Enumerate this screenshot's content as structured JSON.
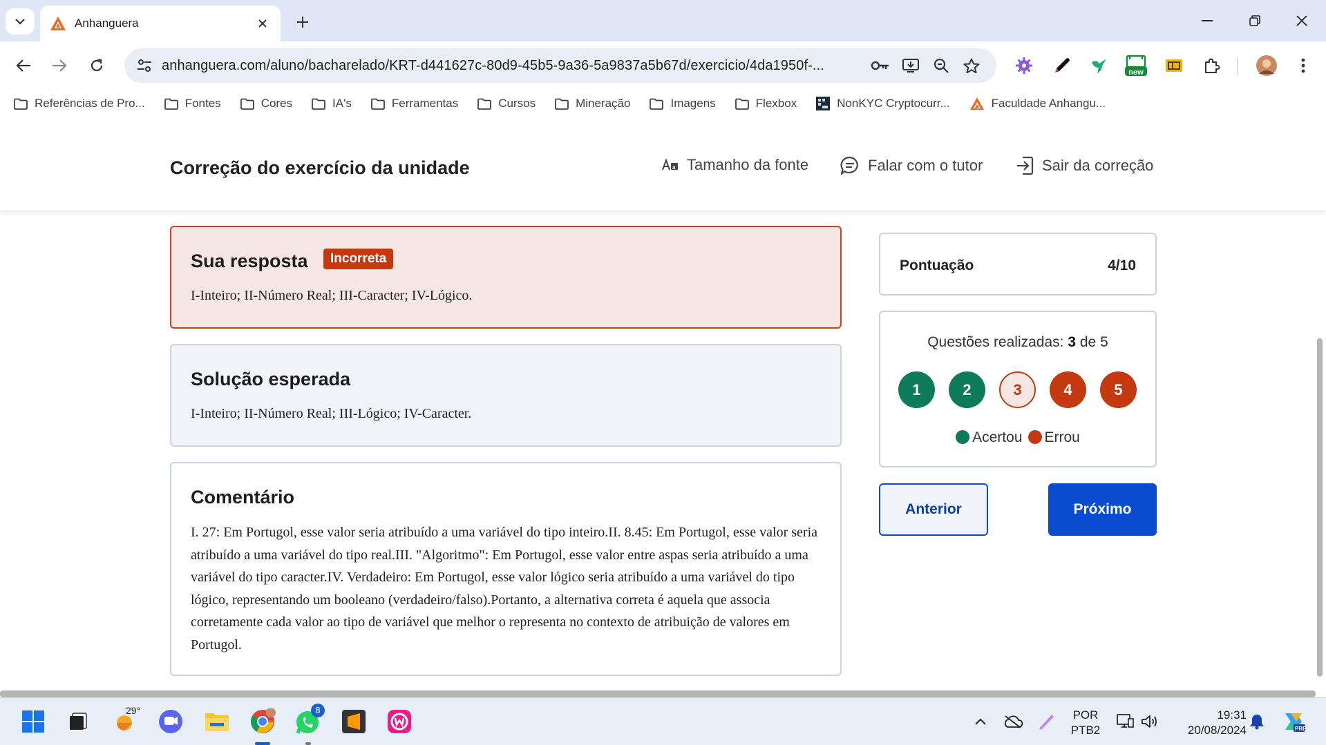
{
  "browser": {
    "tab_title": "Anhanguera",
    "url": "anhanguera.com/aluno/bacharelado/KRT-d441627c-80d9-45b5-9a36-5a9837a5b67d/exercicio/4da1950f-...",
    "new_badge": "new"
  },
  "bookmarks": [
    {
      "label": "Referências de Pro...",
      "icon": "folder-icon"
    },
    {
      "label": "Fontes",
      "icon": "folder-icon"
    },
    {
      "label": "Cores",
      "icon": "folder-icon"
    },
    {
      "label": "IA's",
      "icon": "folder-icon"
    },
    {
      "label": "Ferramentas",
      "icon": "folder-icon"
    },
    {
      "label": "Cursos",
      "icon": "folder-icon"
    },
    {
      "label": "Mineração",
      "icon": "folder-icon"
    },
    {
      "label": "Imagens",
      "icon": "folder-icon"
    },
    {
      "label": "Flexbox",
      "icon": "folder-icon"
    },
    {
      "label": "NonKYC Cryptocurr...",
      "icon": "nonkyc-icon"
    },
    {
      "label": "Faculdade Anhangu...",
      "icon": "anhanguera-icon"
    }
  ],
  "header": {
    "title": "Correção do exercício da unidade",
    "font_size_label": "Tamanho da fonte",
    "tutor_label": "Falar com o tutor",
    "exit_label": "Sair da correção"
  },
  "answer": {
    "title": "Sua resposta",
    "badge": "Incorreta",
    "text": "I-Inteiro; II-Número Real; III-Caracter; IV-Lógico."
  },
  "expected": {
    "title": "Solução esperada",
    "text": "I-Inteiro; II-Número Real; III-Lógico; IV-Caracter."
  },
  "comment": {
    "title": "Comentário",
    "text": "I. 27: Em Portugol, esse valor seria atribuído a uma variável do tipo inteiro.II. 8.45: Em Portugol, esse valor seria atribuído a uma variável do tipo real.III. \"Algoritmo\": Em Portugol, esse valor entre aspas seria atribuído a uma variável do tipo caracter.IV. Verdadeiro: Em Portugol, esse valor lógico seria atribuído a uma variável do tipo lógico, representando um booleano (verdadeiro/falso).Portanto, a alternativa correta é aquela que associa corretamente cada valor ao tipo de variável que melhor o representa no contexto de atribuição de valores em Portugol."
  },
  "score": {
    "label": "Pontuação",
    "value": "4/10"
  },
  "questions": {
    "prefix": "Questões realizadas:",
    "done": "3",
    "of": "de",
    "total": "5",
    "items": [
      {
        "number": "1",
        "status": "correct"
      },
      {
        "number": "2",
        "status": "correct"
      },
      {
        "number": "3",
        "status": "current-wrong"
      },
      {
        "number": "4",
        "status": "wrong"
      },
      {
        "number": "5",
        "status": "wrong"
      }
    ],
    "legend_correct": "Acertou",
    "legend_wrong": "Errou"
  },
  "nav": {
    "prev": "Anterior",
    "next": "Próximo"
  },
  "colors": {
    "correct": "#0d7a5a",
    "wrong": "#c4390f",
    "primary": "#0a4ccf"
  },
  "taskbar": {
    "weather": "29°",
    "whatsapp_badge": "8",
    "lang_top": "POR",
    "lang_bottom": "PTB2",
    "time": "19:31",
    "date": "20/08/2024"
  }
}
